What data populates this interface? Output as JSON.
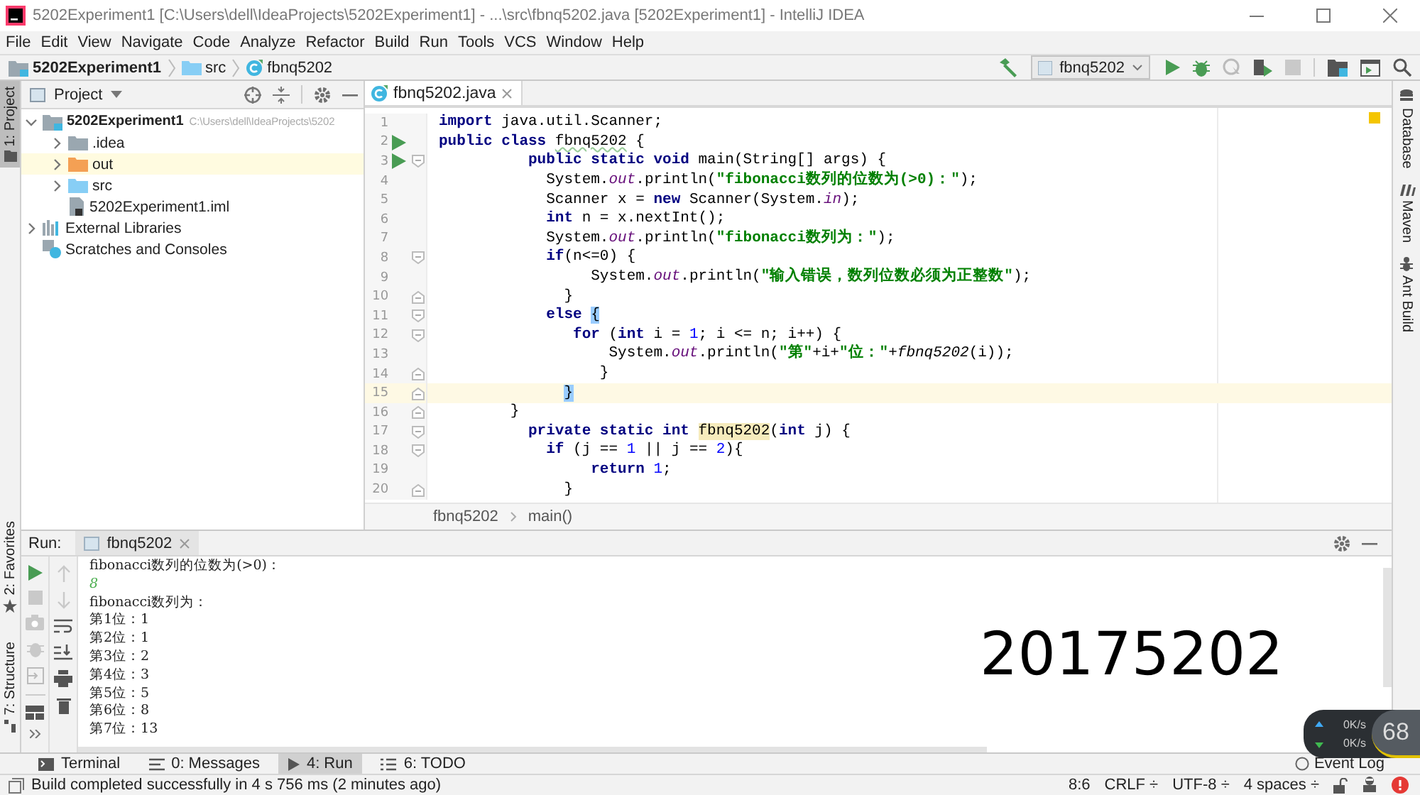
{
  "window": {
    "title": "5202Experiment1 [C:\\Users\\dell\\IdeaProjects\\5202Experiment1] - ...\\src\\fbnq5202.java [5202Experiment1] - IntelliJ IDEA"
  },
  "menu": [
    "File",
    "Edit",
    "View",
    "Navigate",
    "Code",
    "Analyze",
    "Refactor",
    "Build",
    "Run",
    "Tools",
    "VCS",
    "Window",
    "Help"
  ],
  "breadcrumbs": [
    {
      "label": "5202Experiment1",
      "kind": "module"
    },
    {
      "label": "src",
      "kind": "folder"
    },
    {
      "label": "fbnq5202",
      "kind": "class"
    }
  ],
  "run_config": "fbnq5202",
  "left_tabs": [
    {
      "label": "1: Project",
      "selected": true,
      "kind": "project"
    },
    {
      "label": "2: Favorites",
      "selected": false,
      "kind": "favorites"
    },
    {
      "label": "7: Structure",
      "selected": false,
      "kind": "structure"
    }
  ],
  "right_tabs": [
    {
      "label": "Database",
      "kind": "database"
    },
    {
      "label": "Maven",
      "kind": "maven"
    },
    {
      "label": "Ant Build",
      "kind": "ant"
    }
  ],
  "project_panel": {
    "title": "Project",
    "tree": [
      {
        "label": "5202Experiment1",
        "path": "C:\\Users\\dell\\IdeaProjects\\5202",
        "kind": "module",
        "expandable": true,
        "expanded": true,
        "highlighted": false,
        "children": [
          {
            "label": ".idea",
            "kind": "folder",
            "expandable": true,
            "expanded": false,
            "highlighted": false
          },
          {
            "label": "out",
            "kind": "excluded",
            "expandable": true,
            "expanded": false,
            "highlighted": true
          },
          {
            "label": "src",
            "kind": "source",
            "expandable": true,
            "expanded": false,
            "highlighted": false
          },
          {
            "label": "5202Experiment1.iml",
            "kind": "iml",
            "expandable": false,
            "expanded": false,
            "highlighted": false
          }
        ]
      },
      {
        "label": "External Libraries",
        "kind": "libraries",
        "expandable": true,
        "expanded": false,
        "highlighted": false
      },
      {
        "label": "Scratches and Consoles",
        "kind": "scratches",
        "expandable": false,
        "expanded": false,
        "highlighted": false
      }
    ]
  },
  "editor": {
    "tabs": [
      {
        "label": "fbnq5202.java",
        "selected": true
      }
    ],
    "lines": [
      {
        "number": "1",
        "run": false,
        "fold_open": false,
        "fold_close": false,
        "current": false,
        "segments": [
          {
            "kind": "kw",
            "text": "import"
          },
          {
            "kind": "plain",
            "text": " java.util.Scanner;"
          }
        ]
      },
      {
        "number": "2",
        "run": true,
        "fold_open": false,
        "fold_close": false,
        "current": false,
        "segments": [
          {
            "kind": "kw",
            "text": "public class "
          },
          {
            "kind": "warn",
            "text": "fbnq5202"
          },
          {
            "kind": "plain",
            "text": " {"
          }
        ]
      },
      {
        "number": "3",
        "run": true,
        "fold_open": true,
        "fold_close": false,
        "current": false,
        "segments": [
          {
            "kind": "kw",
            "text": "          public static void"
          },
          {
            "kind": "plain",
            "text": " main(String[] args) {"
          }
        ]
      },
      {
        "number": "4",
        "run": false,
        "fold_open": false,
        "fold_close": false,
        "current": false,
        "segments": [
          {
            "kind": "plain",
            "text": "            System."
          },
          {
            "kind": "field",
            "text": "out"
          },
          {
            "kind": "plain",
            "text": ".println("
          },
          {
            "kind": "str",
            "text": "\"fibonacci数列的位数为(>0)：\""
          },
          {
            "kind": "plain",
            "text": ");"
          }
        ]
      },
      {
        "number": "5",
        "run": false,
        "fold_open": false,
        "fold_close": false,
        "current": false,
        "segments": [
          {
            "kind": "plain",
            "text": "            Scanner x = "
          },
          {
            "kind": "kw",
            "text": "new"
          },
          {
            "kind": "plain",
            "text": " Scanner(System."
          },
          {
            "kind": "field",
            "text": "in"
          },
          {
            "kind": "plain",
            "text": ");"
          }
        ]
      },
      {
        "number": "6",
        "run": false,
        "fold_open": false,
        "fold_close": false,
        "current": false,
        "segments": [
          {
            "kind": "kw",
            "text": "            int"
          },
          {
            "kind": "plain",
            "text": " n = x.nextInt();"
          }
        ]
      },
      {
        "number": "7",
        "run": false,
        "fold_open": false,
        "fold_close": false,
        "current": false,
        "segments": [
          {
            "kind": "plain",
            "text": "            System."
          },
          {
            "kind": "field",
            "text": "out"
          },
          {
            "kind": "plain",
            "text": ".println("
          },
          {
            "kind": "str",
            "text": "\"fibonacci数列为：\""
          },
          {
            "kind": "plain",
            "text": ");"
          }
        ]
      },
      {
        "number": "8",
        "run": false,
        "fold_open": true,
        "fold_close": false,
        "current": false,
        "segments": [
          {
            "kind": "kw",
            "text": "            if"
          },
          {
            "kind": "plain",
            "text": "(n<=0) {"
          }
        ]
      },
      {
        "number": "9",
        "run": false,
        "fold_open": false,
        "fold_close": false,
        "current": false,
        "segments": [
          {
            "kind": "plain",
            "text": "                 System."
          },
          {
            "kind": "field",
            "text": "out"
          },
          {
            "kind": "plain",
            "text": ".println("
          },
          {
            "kind": "str",
            "text": "\"输入错误，数列位数必须为正整数\""
          },
          {
            "kind": "plain",
            "text": ");"
          }
        ]
      },
      {
        "number": "10",
        "run": false,
        "fold_open": false,
        "fold_close": true,
        "current": false,
        "segments": [
          {
            "kind": "plain",
            "text": "              }"
          }
        ]
      },
      {
        "number": "11",
        "run": false,
        "fold_open": true,
        "fold_close": false,
        "current": false,
        "segments": [
          {
            "kind": "kw",
            "text": "            else "
          },
          {
            "kind": "brace",
            "text": "{"
          }
        ]
      },
      {
        "number": "12",
        "run": false,
        "fold_open": true,
        "fold_close": false,
        "current": false,
        "segments": [
          {
            "kind": "kw",
            "text": "               for"
          },
          {
            "kind": "plain",
            "text": " ("
          },
          {
            "kind": "kw",
            "text": "int"
          },
          {
            "kind": "plain",
            "text": " i = "
          },
          {
            "kind": "num",
            "text": "1"
          },
          {
            "kind": "plain",
            "text": "; i <= n; i++) {"
          }
        ]
      },
      {
        "number": "13",
        "run": false,
        "fold_open": false,
        "fold_close": false,
        "current": false,
        "segments": [
          {
            "kind": "plain",
            "text": "                   System."
          },
          {
            "kind": "field",
            "text": "out"
          },
          {
            "kind": "plain",
            "text": ".println("
          },
          {
            "kind": "str",
            "text": "\"第\""
          },
          {
            "kind": "plain",
            "text": "+i+"
          },
          {
            "kind": "str",
            "text": "\"位：\""
          },
          {
            "kind": "plain",
            "text": "+"
          },
          {
            "kind": "call",
            "text": "fbnq5202"
          },
          {
            "kind": "plain",
            "text": "(i));"
          }
        ]
      },
      {
        "number": "14",
        "run": false,
        "fold_open": false,
        "fold_close": true,
        "current": false,
        "segments": [
          {
            "kind": "plain",
            "text": "                  }"
          }
        ]
      },
      {
        "number": "15",
        "run": false,
        "fold_open": false,
        "fold_close": true,
        "current": true,
        "segments": [
          {
            "kind": "brace",
            "text": "              }"
          }
        ]
      },
      {
        "number": "16",
        "run": false,
        "fold_open": false,
        "fold_close": true,
        "current": false,
        "segments": [
          {
            "kind": "plain",
            "text": "        }"
          }
        ]
      },
      {
        "number": "17",
        "run": false,
        "fold_open": true,
        "fold_close": false,
        "current": false,
        "segments": [
          {
            "kind": "kw",
            "text": "          private static int "
          },
          {
            "kind": "hl",
            "text": "fbnq5202"
          },
          {
            "kind": "plain",
            "text": "("
          },
          {
            "kind": "kw",
            "text": "int"
          },
          {
            "kind": "plain",
            "text": " j) {"
          }
        ]
      },
      {
        "number": "18",
        "run": false,
        "fold_open": true,
        "fold_close": false,
        "current": false,
        "segments": [
          {
            "kind": "kw",
            "text": "            if"
          },
          {
            "kind": "plain",
            "text": " (j == "
          },
          {
            "kind": "num",
            "text": "1"
          },
          {
            "kind": "plain",
            "text": " || j == "
          },
          {
            "kind": "num",
            "text": "2"
          },
          {
            "kind": "plain",
            "text": "){"
          }
        ]
      },
      {
        "number": "19",
        "run": false,
        "fold_open": false,
        "fold_close": false,
        "current": false,
        "segments": [
          {
            "kind": "kw",
            "text": "                 return "
          },
          {
            "kind": "num",
            "text": "1"
          },
          {
            "kind": "plain",
            "text": ";"
          }
        ]
      },
      {
        "number": "20",
        "run": false,
        "fold_open": false,
        "fold_close": true,
        "current": false,
        "segments": [
          {
            "kind": "plain",
            "text": "              }"
          }
        ]
      }
    ],
    "breadcrumbs": [
      "fbnq5202",
      "main()"
    ]
  },
  "run_panel": {
    "title": "Run:",
    "tabs": [
      {
        "label": "fbnq5202",
        "selected": true
      }
    ],
    "output": [
      {
        "text": "fibonacci数列的位数为(>0)：",
        "kind": "out"
      },
      {
        "text": "8",
        "kind": "input"
      },
      {
        "text": "fibonacci数列为：",
        "kind": "out"
      },
      {
        "text": "第1位：1",
        "kind": "out"
      },
      {
        "text": "第2位：1",
        "kind": "out"
      },
      {
        "text": "第3位：2",
        "kind": "out"
      },
      {
        "text": "第4位：3",
        "kind": "out"
      },
      {
        "text": "第5位：5",
        "kind": "out"
      },
      {
        "text": "第6位：8",
        "kind": "out"
      },
      {
        "text": "第7位：13",
        "kind": "out"
      }
    ],
    "overlay_text": "20175202"
  },
  "tool_tabs": [
    {
      "label": "Terminal",
      "kind": "terminal",
      "selected": false
    },
    {
      "label": "0: Messages",
      "kind": "messages",
      "selected": false
    },
    {
      "label": "4: Run",
      "kind": "run",
      "selected": true
    },
    {
      "label": "6: TODO",
      "kind": "todo",
      "selected": false
    }
  ],
  "event_log": "Event Log",
  "status_bar": {
    "message": "Build completed successfully in 4 s 756 ms (2 minutes ago)",
    "position": "8:6",
    "line_separator": "CRLF ÷",
    "encoding": "UTF-8 ÷",
    "indent": "4 spaces ÷"
  },
  "network_widget": {
    "upload": "0K/s",
    "download": "0K/s",
    "load": "68"
  }
}
